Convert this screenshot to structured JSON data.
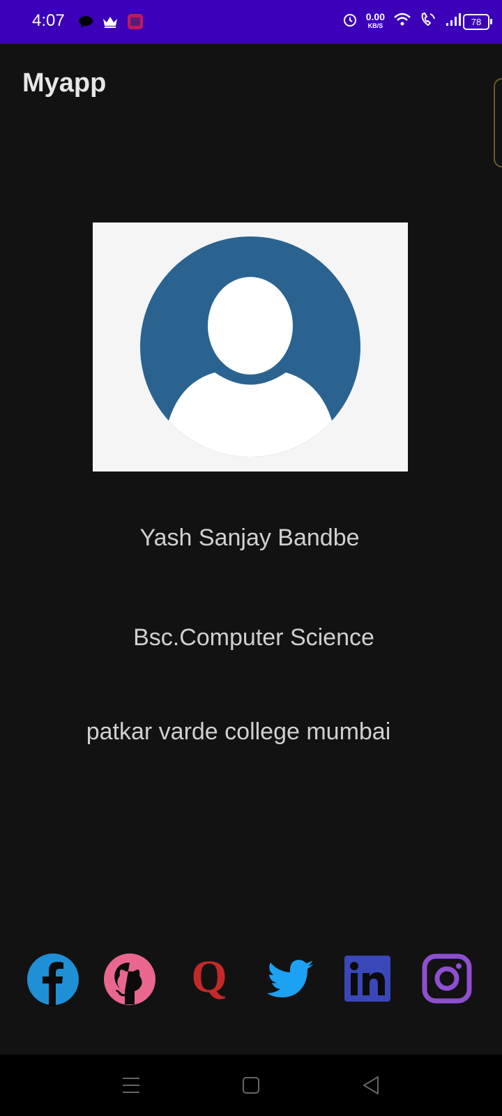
{
  "status_bar": {
    "time": "4:07",
    "net_speed_value": "0.00",
    "net_speed_unit": "KB/S",
    "battery": "78",
    "left_icons": [
      "chat-bubble-icon",
      "crown-icon",
      "yono-sbi-app-icon"
    ],
    "right_icons": [
      "alarm-icon",
      "wifi-icon",
      "wifi-calling-icon",
      "signal-icon",
      "battery-icon"
    ],
    "bg_color": "#3b00b8"
  },
  "app_bar": {
    "title": "Myapp"
  },
  "profile": {
    "avatar_icon": "user-avatar-icon",
    "name": "Yash Sanjay Bandbe",
    "course": "Bsc.Computer Science",
    "college": "patkar varde college mumbai"
  },
  "social_links": [
    {
      "name": "facebook",
      "icon": "facebook-icon",
      "color": "#1f8fd6"
    },
    {
      "name": "github",
      "icon": "github-icon",
      "color": "#e9678e"
    },
    {
      "name": "quora",
      "icon": "quora-icon",
      "color": "#c22a2a"
    },
    {
      "name": "twitter",
      "icon": "twitter-icon",
      "color": "#1da1f2"
    },
    {
      "name": "linkedin",
      "icon": "linkedin-icon",
      "color": "#3a47b8"
    },
    {
      "name": "instagram",
      "icon": "instagram-icon",
      "color": "#8e4fd1"
    }
  ],
  "nav_bar": {
    "buttons": [
      "menu-icon",
      "home-icon",
      "back-icon"
    ]
  }
}
